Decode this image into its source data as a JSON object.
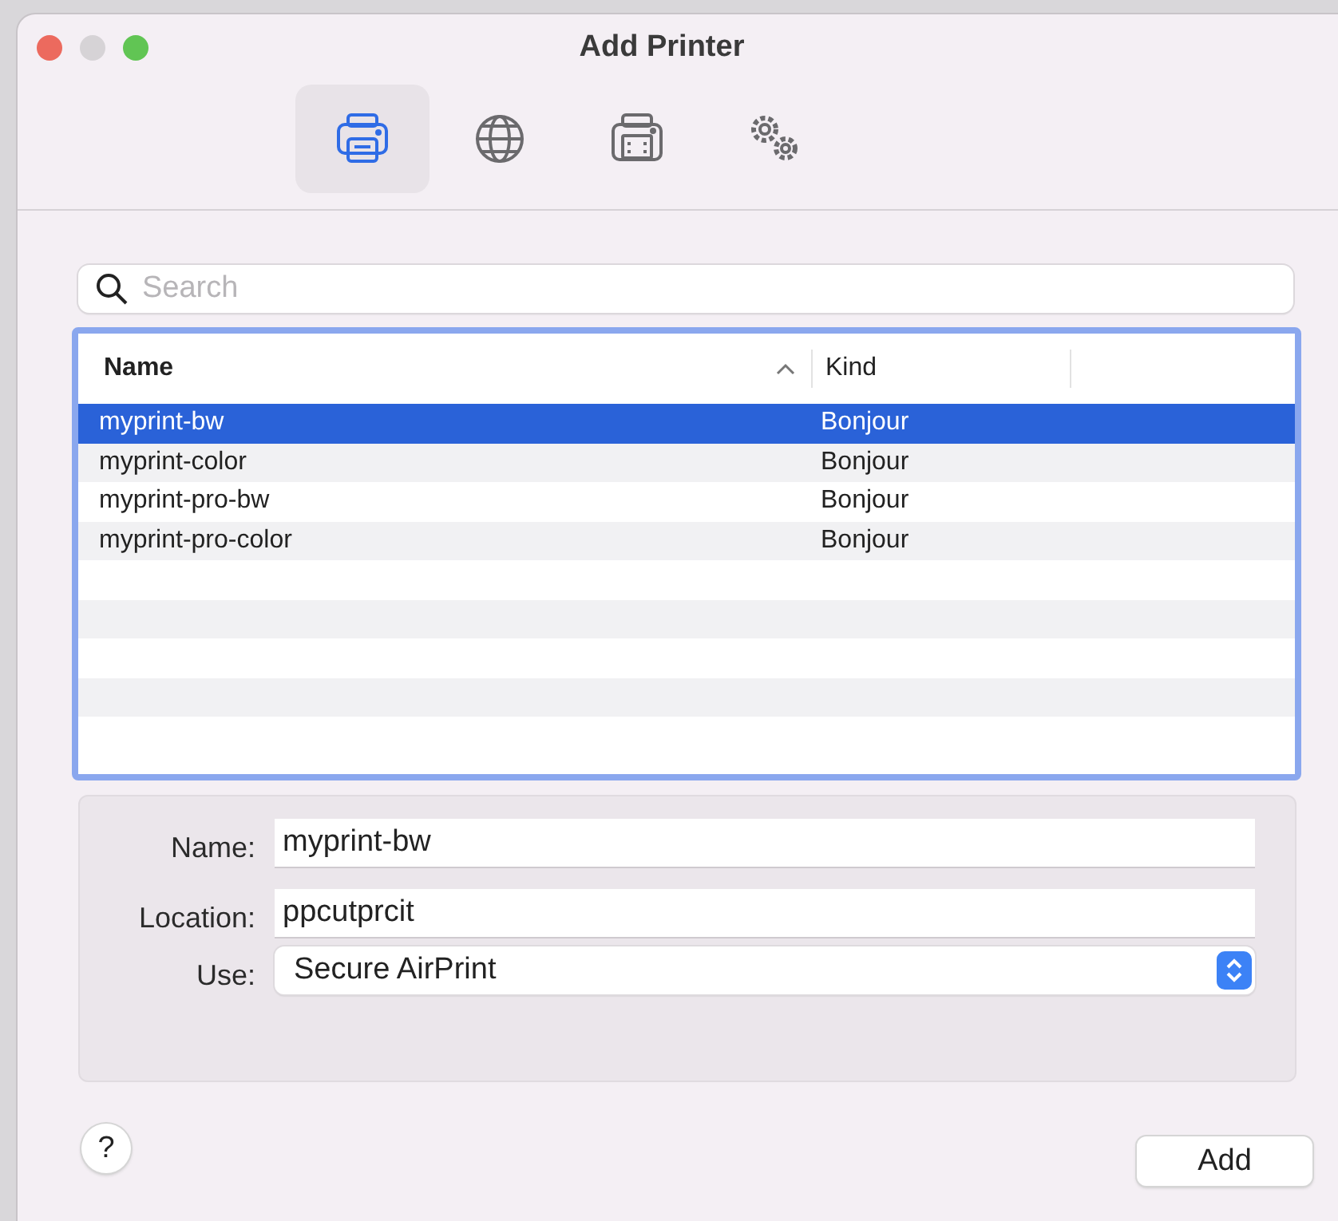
{
  "window": {
    "title": "Add Printer"
  },
  "toolbar": [
    {
      "kind": "printer",
      "selected": true
    },
    {
      "kind": "globe",
      "selected": false
    },
    {
      "kind": "fax",
      "selected": false
    },
    {
      "kind": "gears",
      "selected": false
    }
  ],
  "search": {
    "placeholder": "Search"
  },
  "table": {
    "columns": [
      {
        "label": "Name",
        "sorted": true
      },
      {
        "label": "Kind",
        "sorted": false
      }
    ],
    "rows": [
      {
        "name": "myprint-bw",
        "kind": "Bonjour",
        "selected": true
      },
      {
        "name": "myprint-color",
        "kind": "Bonjour",
        "selected": false
      },
      {
        "name": "myprint-pro-bw",
        "kind": "Bonjour",
        "selected": false
      },
      {
        "name": "myprint-pro-color",
        "kind": "Bonjour",
        "selected": false
      }
    ]
  },
  "form": {
    "name": {
      "label": "Name:",
      "value": "myprint-bw"
    },
    "location": {
      "label": "Location:",
      "value": "ppcutprcit"
    },
    "use": {
      "label": "Use:",
      "value": "Secure AirPrint"
    }
  },
  "help_button": "?",
  "add_button": "Add"
}
